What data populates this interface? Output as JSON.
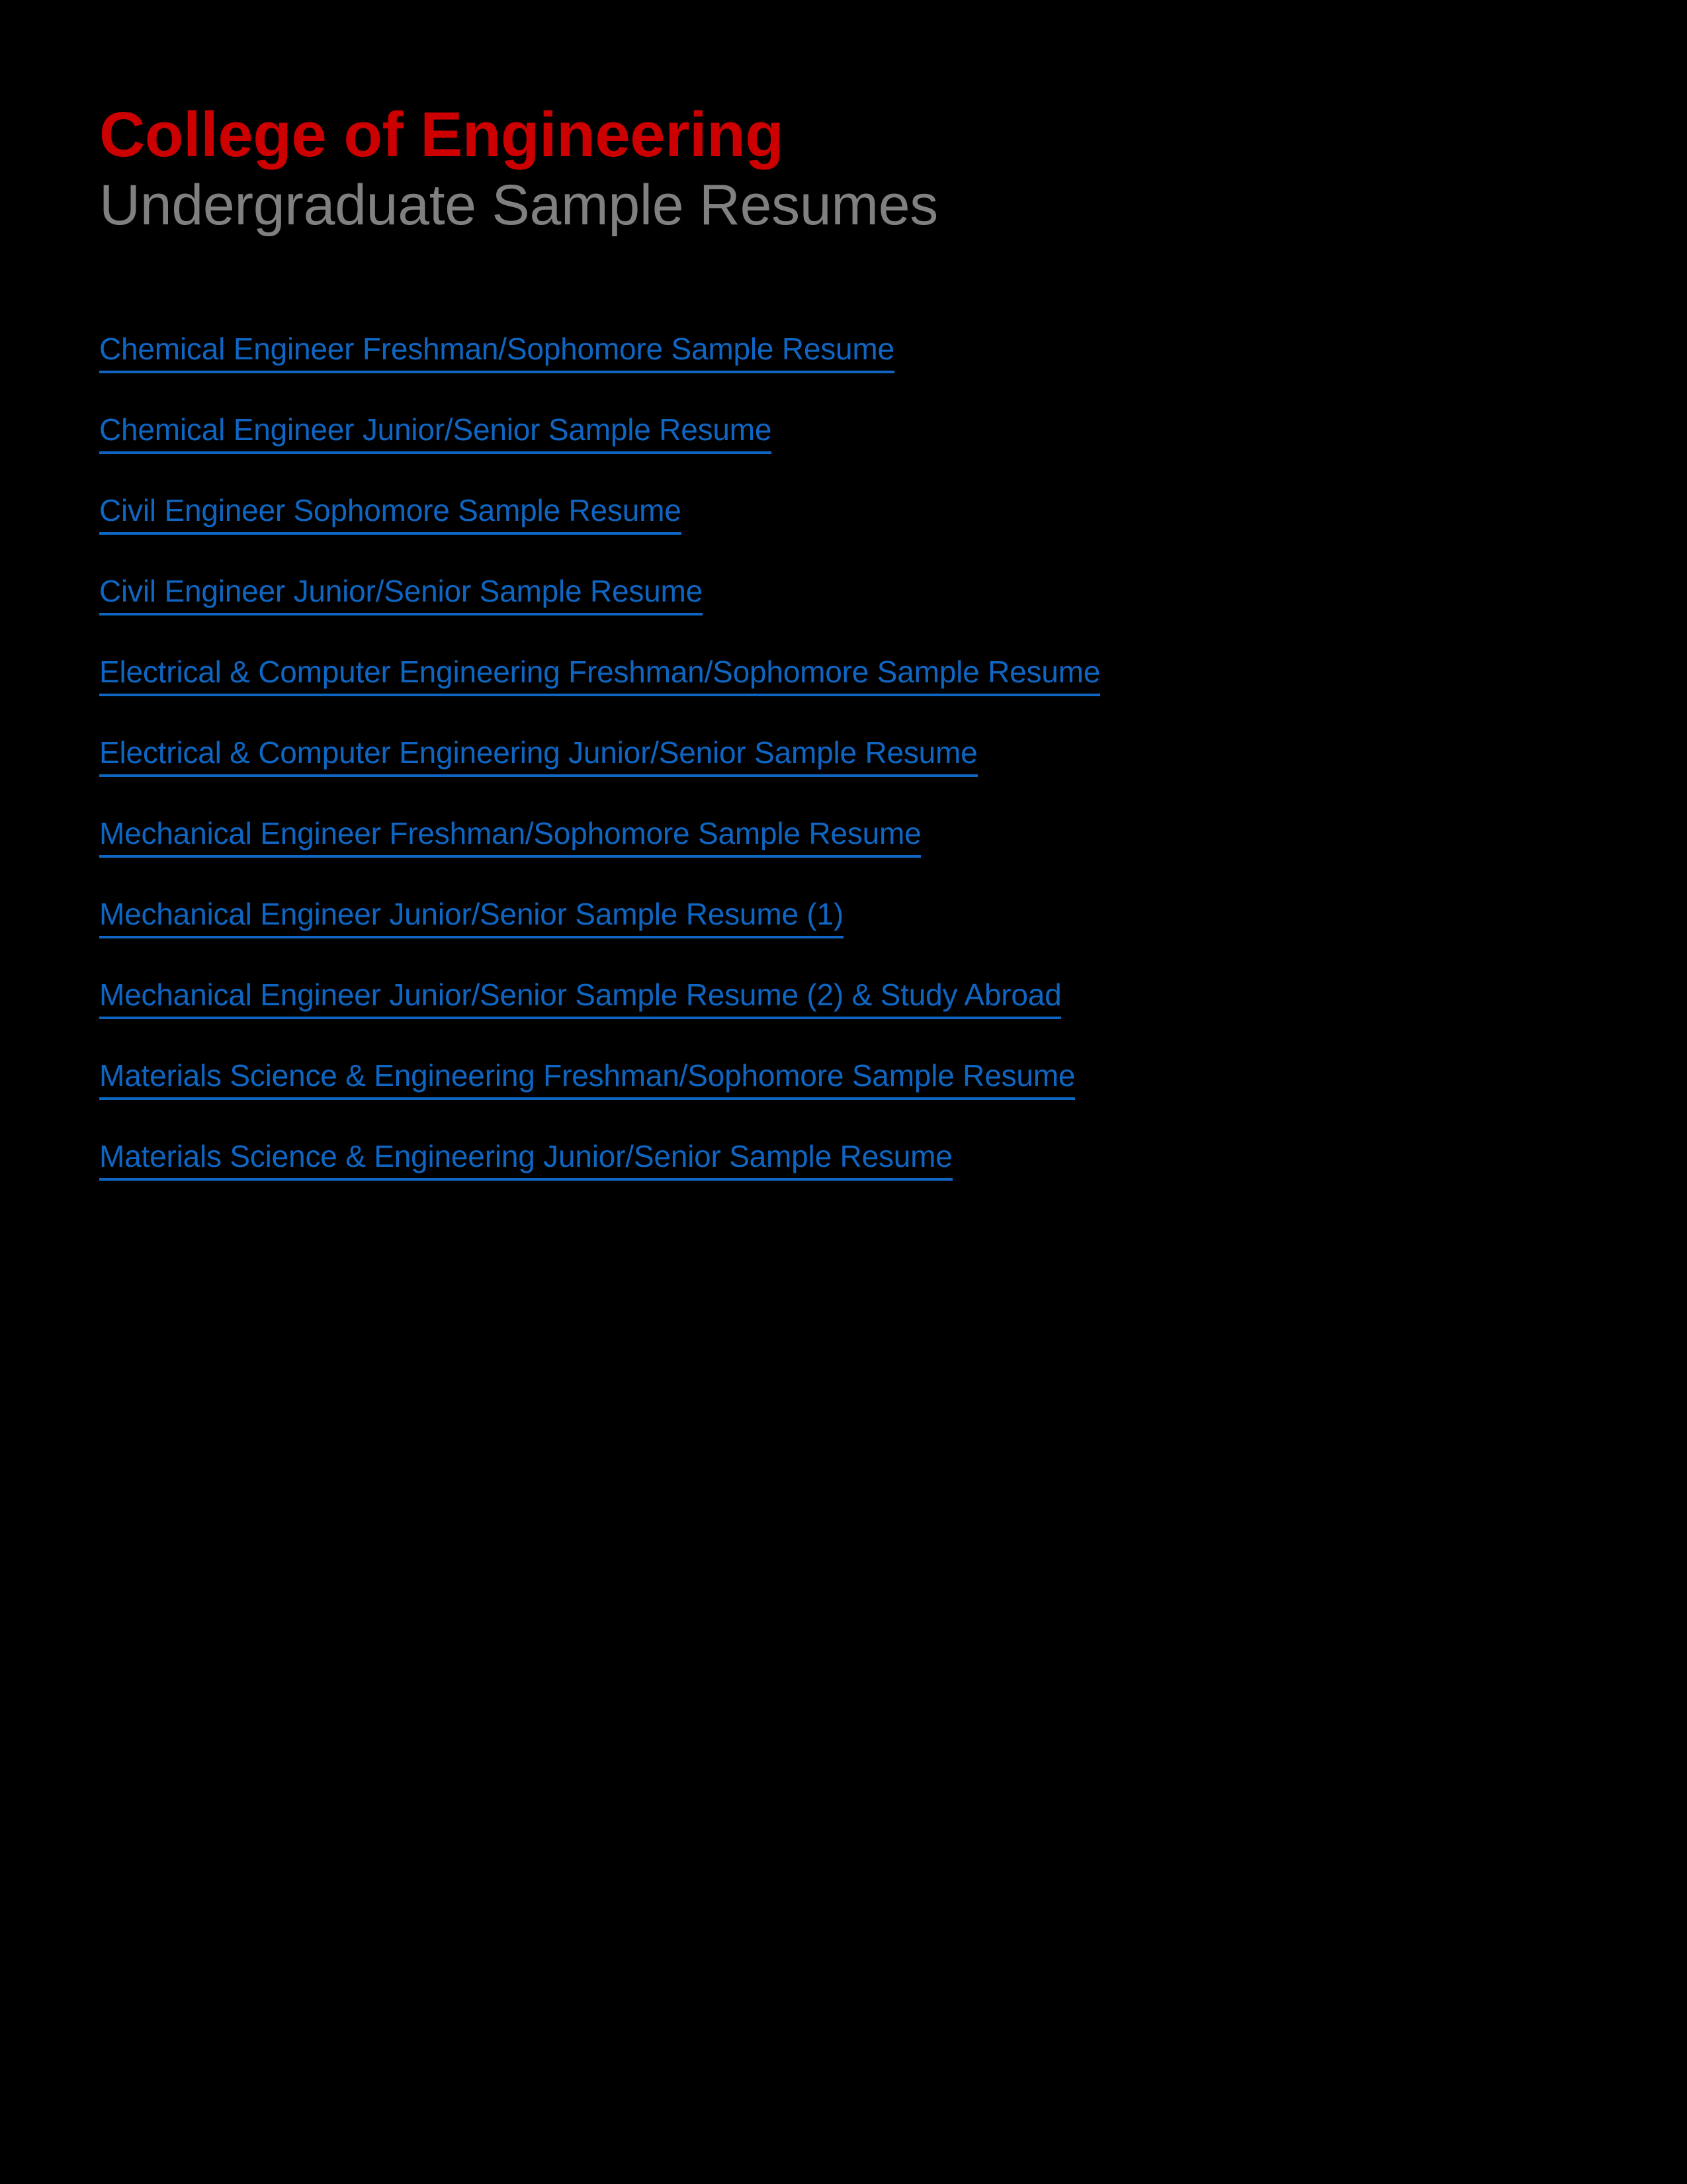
{
  "page": {
    "background_color": "#000000"
  },
  "header": {
    "title": "College of Engineering",
    "title_color": "#CC0000",
    "subtitle": "Undergraduate Sample Resumes",
    "subtitle_color": "#808080"
  },
  "links": {
    "color": "#0F66C2",
    "items": [
      {
        "label": "Chemical Engineer Freshman/Sophomore Sample Resume"
      },
      {
        "label": "Chemical Engineer Junior/Senior Sample Resume"
      },
      {
        "label": "Civil Engineer Sophomore Sample Resume"
      },
      {
        "label": "Civil Engineer Junior/Senior Sample Resume"
      },
      {
        "label": "Electrical & Computer Engineering Freshman/Sophomore Sample Resume"
      },
      {
        "label": "Electrical & Computer Engineering Junior/Senior Sample Resume"
      },
      {
        "label": "Mechanical Engineer Freshman/Sophomore Sample Resume"
      },
      {
        "label": "Mechanical Engineer Junior/Senior Sample Resume (1)"
      },
      {
        "label": "Mechanical Engineer Junior/Senior Sample Resume (2) & Study Abroad"
      },
      {
        "label": "Materials Science & Engineering Freshman/Sophomore Sample Resume"
      },
      {
        "label": "Materials Science & Engineering Junior/Senior Sample Resume"
      }
    ]
  }
}
